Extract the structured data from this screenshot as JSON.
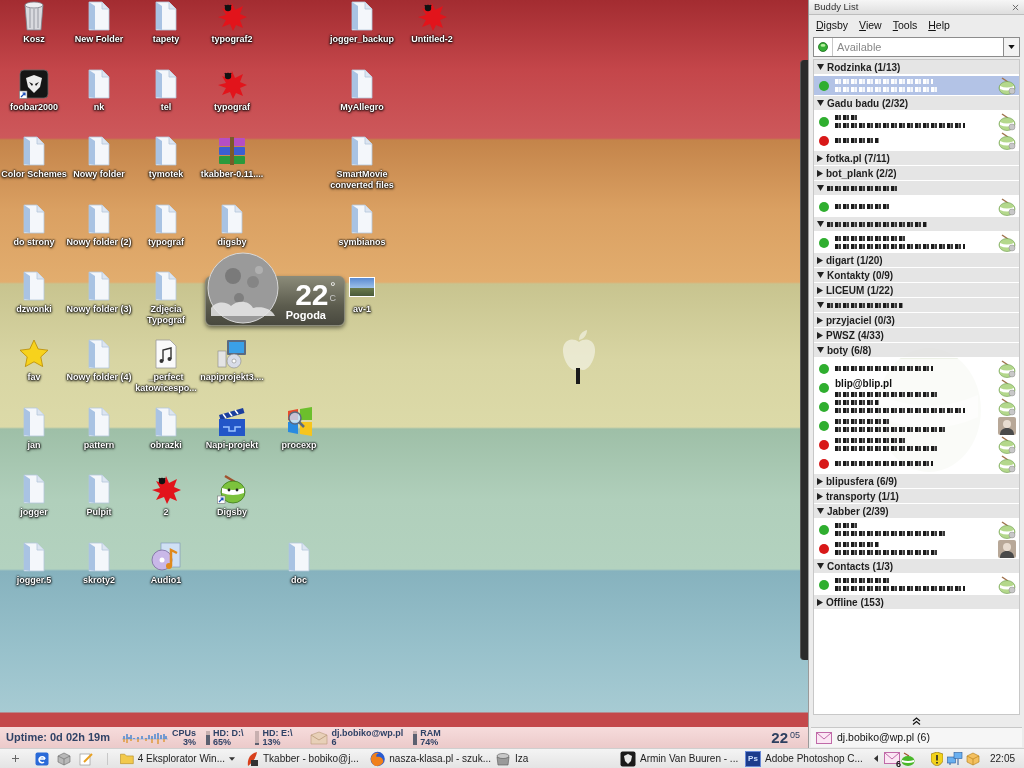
{
  "desktop": {
    "icons": [
      {
        "label": "Kosz",
        "kind": "trash"
      },
      {
        "label": "New Folder",
        "kind": "folder"
      },
      {
        "label": "tapety",
        "kind": "folder"
      },
      {
        "label": "typograf2",
        "kind": "splat"
      },
      {
        "label": "jogger_backup",
        "kind": "folder"
      },
      {
        "label": "Untitled-2",
        "kind": "splat"
      },
      {
        "label": "foobar2000",
        "kind": "alien"
      },
      {
        "label": "nk",
        "kind": "folder"
      },
      {
        "label": "tel",
        "kind": "folder"
      },
      {
        "label": "typograf",
        "kind": "splat"
      },
      {
        "label": "MyAllegro",
        "kind": "folder"
      },
      {
        "label": "Color Schemes",
        "kind": "folder"
      },
      {
        "label": "Nowy folder",
        "kind": "folder"
      },
      {
        "label": "tymotek",
        "kind": "folder"
      },
      {
        "label": "tkabber-0.11....",
        "kind": "archive"
      },
      {
        "label": "SmartMovie converted files",
        "kind": "folder"
      },
      {
        "label": "do strony",
        "kind": "folder"
      },
      {
        "label": "Nowy folder (2)",
        "kind": "folder"
      },
      {
        "label": "typograf",
        "kind": "folder"
      },
      {
        "label": "digsby",
        "kind": "folder"
      },
      {
        "label": "symbianos",
        "kind": "folder"
      },
      {
        "label": "dzwonki",
        "kind": "folder"
      },
      {
        "label": "Nowy folder (3)",
        "kind": "folder"
      },
      {
        "label": "Zdjęcia Typograf",
        "kind": "folder"
      },
      {
        "label": "av-1",
        "kind": "photo"
      },
      {
        "label": "fav",
        "kind": "star"
      },
      {
        "label": "Nowy folder (4)",
        "kind": "folder"
      },
      {
        "label": "_perfect katowicespo...",
        "kind": "music"
      },
      {
        "label": "napiprojekt3....",
        "kind": "installer"
      },
      {
        "label": "jan",
        "kind": "folder"
      },
      {
        "label": "pattern",
        "kind": "folder"
      },
      {
        "label": "obrazki",
        "kind": "folder"
      },
      {
        "label": "Napi-projekt",
        "kind": "clapper"
      },
      {
        "label": "procexp",
        "kind": "procexp"
      },
      {
        "label": "jogger",
        "kind": "folder"
      },
      {
        "label": "Pulpit",
        "kind": "folder"
      },
      {
        "label": "2",
        "kind": "splat"
      },
      {
        "label": "Digsby",
        "kind": "digsby"
      },
      {
        "label": "jogger.5",
        "kind": "folder"
      },
      {
        "label": "skroty2",
        "kind": "folder"
      },
      {
        "label": "Audio1",
        "kind": "audio"
      },
      {
        "label": "doc",
        "kind": "folder"
      }
    ],
    "weather": {
      "temperature": "22",
      "degree": "°",
      "unit": "C",
      "caption": "Pogoda"
    }
  },
  "status_bar": {
    "uptime": "Uptime: 0d 02h 19m",
    "meters": [
      {
        "kind": "graph",
        "label": "CPUs",
        "value": "3%"
      },
      {
        "kind": "bar",
        "label": "HD: D:\\",
        "value": "65%",
        "level": 0.65
      },
      {
        "kind": "bar",
        "label": "HD: E:\\",
        "value": "13%",
        "level": 0.13
      },
      {
        "kind": "mail",
        "label": "dj.bobiko@wp.pl",
        "value": "6"
      },
      {
        "kind": "bar",
        "label": "RAM",
        "value": "74%",
        "level": 0.74
      }
    ],
    "clock": {
      "hours": "22",
      "minutes": "05"
    }
  },
  "buddy_list": {
    "title": "Buddy List",
    "menu": [
      "Digsby",
      "View",
      "Tools",
      "Help"
    ],
    "status": "Available",
    "groups": [
      {
        "name": "Rodzinka (1/13)",
        "expanded": true,
        "contacts": [
          {
            "color": "#2fae2f",
            "has_message": true,
            "kind": "digsby",
            "selected": true
          }
        ]
      },
      {
        "name": "Gadu badu (2/32)",
        "expanded": true,
        "contacts": [
          {
            "color": "#2fae2f",
            "has_message": true,
            "kind": "digsby",
            "selected": false
          },
          {
            "color": "#d81818",
            "has_message": false,
            "kind": "digsby",
            "selected": false
          }
        ]
      },
      {
        "name": "fotka.pl (7/11)",
        "expanded": false
      },
      {
        "name": "bot_plank (2/2)",
        "expanded": false
      },
      {
        "expanded": true,
        "contacts": [
          {
            "color": "#2fae2f",
            "has_message": false,
            "kind": "digsby",
            "selected": false
          }
        ]
      },
      {
        "expanded": true,
        "contacts": [
          {
            "color": "#2fae2f",
            "has_message": true,
            "kind": "digsby",
            "selected": false
          }
        ]
      },
      {
        "name": "digart (1/20)",
        "expanded": false
      },
      {
        "name": "Kontakty (0/9)",
        "expanded": true
      },
      {
        "name": "LICEUM (1/22)",
        "expanded": false
      },
      {
        "expanded": true
      },
      {
        "name": "przyjaciel (0/3)",
        "expanded": false
      },
      {
        "name": "PWSZ (4/33)",
        "expanded": false
      },
      {
        "name": "boty (6/8)",
        "expanded": true,
        "contacts": [
          {
            "color": "#2fae2f",
            "has_message": false,
            "kind": "digsby",
            "selected": false
          },
          {
            "name": "blip@blip.pl",
            "color": "#2fae2f",
            "has_message": true,
            "kind": "digsby",
            "selected": false
          },
          {
            "color": "#2fae2f",
            "has_message": true,
            "kind": "digsby",
            "selected": false
          },
          {
            "color": "#2fae2f",
            "has_message": true,
            "kind": "person",
            "selected": false
          },
          {
            "color": "#d81818",
            "has_message": true,
            "kind": "digsby",
            "selected": false
          },
          {
            "color": "#d81818",
            "has_message": false,
            "kind": "digsby",
            "selected": false
          }
        ]
      },
      {
        "name": "blipusfera (6/9)",
        "expanded": false
      },
      {
        "name": "transporty (1/1)",
        "expanded": false
      },
      {
        "name": "Jabber (2/39)",
        "expanded": true,
        "contacts": [
          {
            "color": "#2fae2f",
            "has_message": true,
            "kind": "digsby",
            "selected": false
          },
          {
            "color": "#d81818",
            "has_message": true,
            "kind": "person",
            "selected": false
          }
        ]
      },
      {
        "name": "Contacts (1/3)",
        "expanded": true,
        "contacts": [
          {
            "color": "#2fae2f",
            "has_message": true,
            "kind": "digsby",
            "selected": false
          }
        ]
      },
      {
        "name": "Offline (153)",
        "expanded": false
      }
    ],
    "email": "dj.bobiko@wp.pl (6)"
  },
  "taskbar": {
    "tasks": [
      {
        "label": "4 Eksplorator Win...",
        "kind": "folder",
        "grouped": true
      },
      {
        "label": "Tkabber - bobiko@j...",
        "kind": "feather",
        "grouped": false
      },
      {
        "label": "nasza-klasa.pl - szuk...",
        "kind": "firefox",
        "grouped": false
      },
      {
        "label": "Iza",
        "kind": "pot",
        "grouped": false
      },
      {
        "label": "Armin Van Buuren - ...",
        "kind": "alien",
        "grouped": false
      },
      {
        "label": "Adobe Photoshop C...",
        "kind": "photoshop",
        "icon_text": "Ps",
        "grouped": false
      }
    ],
    "tray": {
      "mail_count": "6",
      "time": "22:05"
    }
  }
}
